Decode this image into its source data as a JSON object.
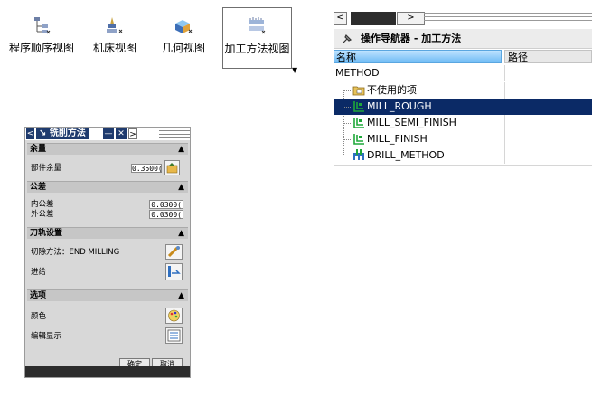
{
  "toolbar": {
    "buttons": [
      {
        "label": "程序顺序视图",
        "icon": "program-order-view-icon"
      },
      {
        "label": "机床视图",
        "icon": "machine-tool-view-icon"
      },
      {
        "label": "几何视图",
        "icon": "geometry-view-icon"
      },
      {
        "label": "加工方法视图",
        "icon": "machining-method-view-icon",
        "active": true
      }
    ],
    "more_icon": "dropdown-arrow-icon"
  },
  "navigator": {
    "scroll_left": "<",
    "scroll_right": ">",
    "title": "操作导航器 - 加工方法",
    "columns": [
      "名称",
      "路径"
    ],
    "rows": [
      {
        "label": "METHOD",
        "icon": "",
        "selected": false
      },
      {
        "label": "不使用的项",
        "icon": "unused-items-icon",
        "selected": false
      },
      {
        "label": "MILL_ROUGH",
        "icon": "mill-method-icon",
        "selected": true
      },
      {
        "label": "MILL_SEMI_FINISH",
        "icon": "mill-method-icon",
        "selected": false
      },
      {
        "label": "MILL_FINISH",
        "icon": "mill-method-icon",
        "selected": false
      },
      {
        "label": "DRILL_METHOD",
        "icon": "drill-method-icon",
        "selected": false
      }
    ],
    "colors": {
      "selection": "#0b2a66",
      "header": "#6fbbf5"
    }
  },
  "dialog": {
    "tab_left": "<",
    "tab_icon": "mill-arrow-icon",
    "title": "铣削方法",
    "tab_min": "—",
    "tab_close": "✕",
    "tab_right": ">",
    "sections": {
      "stock": {
        "title": "余量",
        "part_stock_label": "部件余量",
        "part_stock_value": "0.3500("
      },
      "tolerance": {
        "title": "公差",
        "intol_label": "内公差",
        "intol_value": "0.0300(",
        "outtol_label": "外公差",
        "outtol_value": "0.0300("
      },
      "tool_path": {
        "title": "刀轨设置",
        "cut_method_label": "切除方法：END MILLING",
        "feed_label": "进给"
      },
      "options": {
        "title": "选项",
        "color_label": "颜色",
        "edit_display_label": "编辑显示"
      }
    },
    "ok_label": "确定",
    "cancel_label": "取消"
  }
}
